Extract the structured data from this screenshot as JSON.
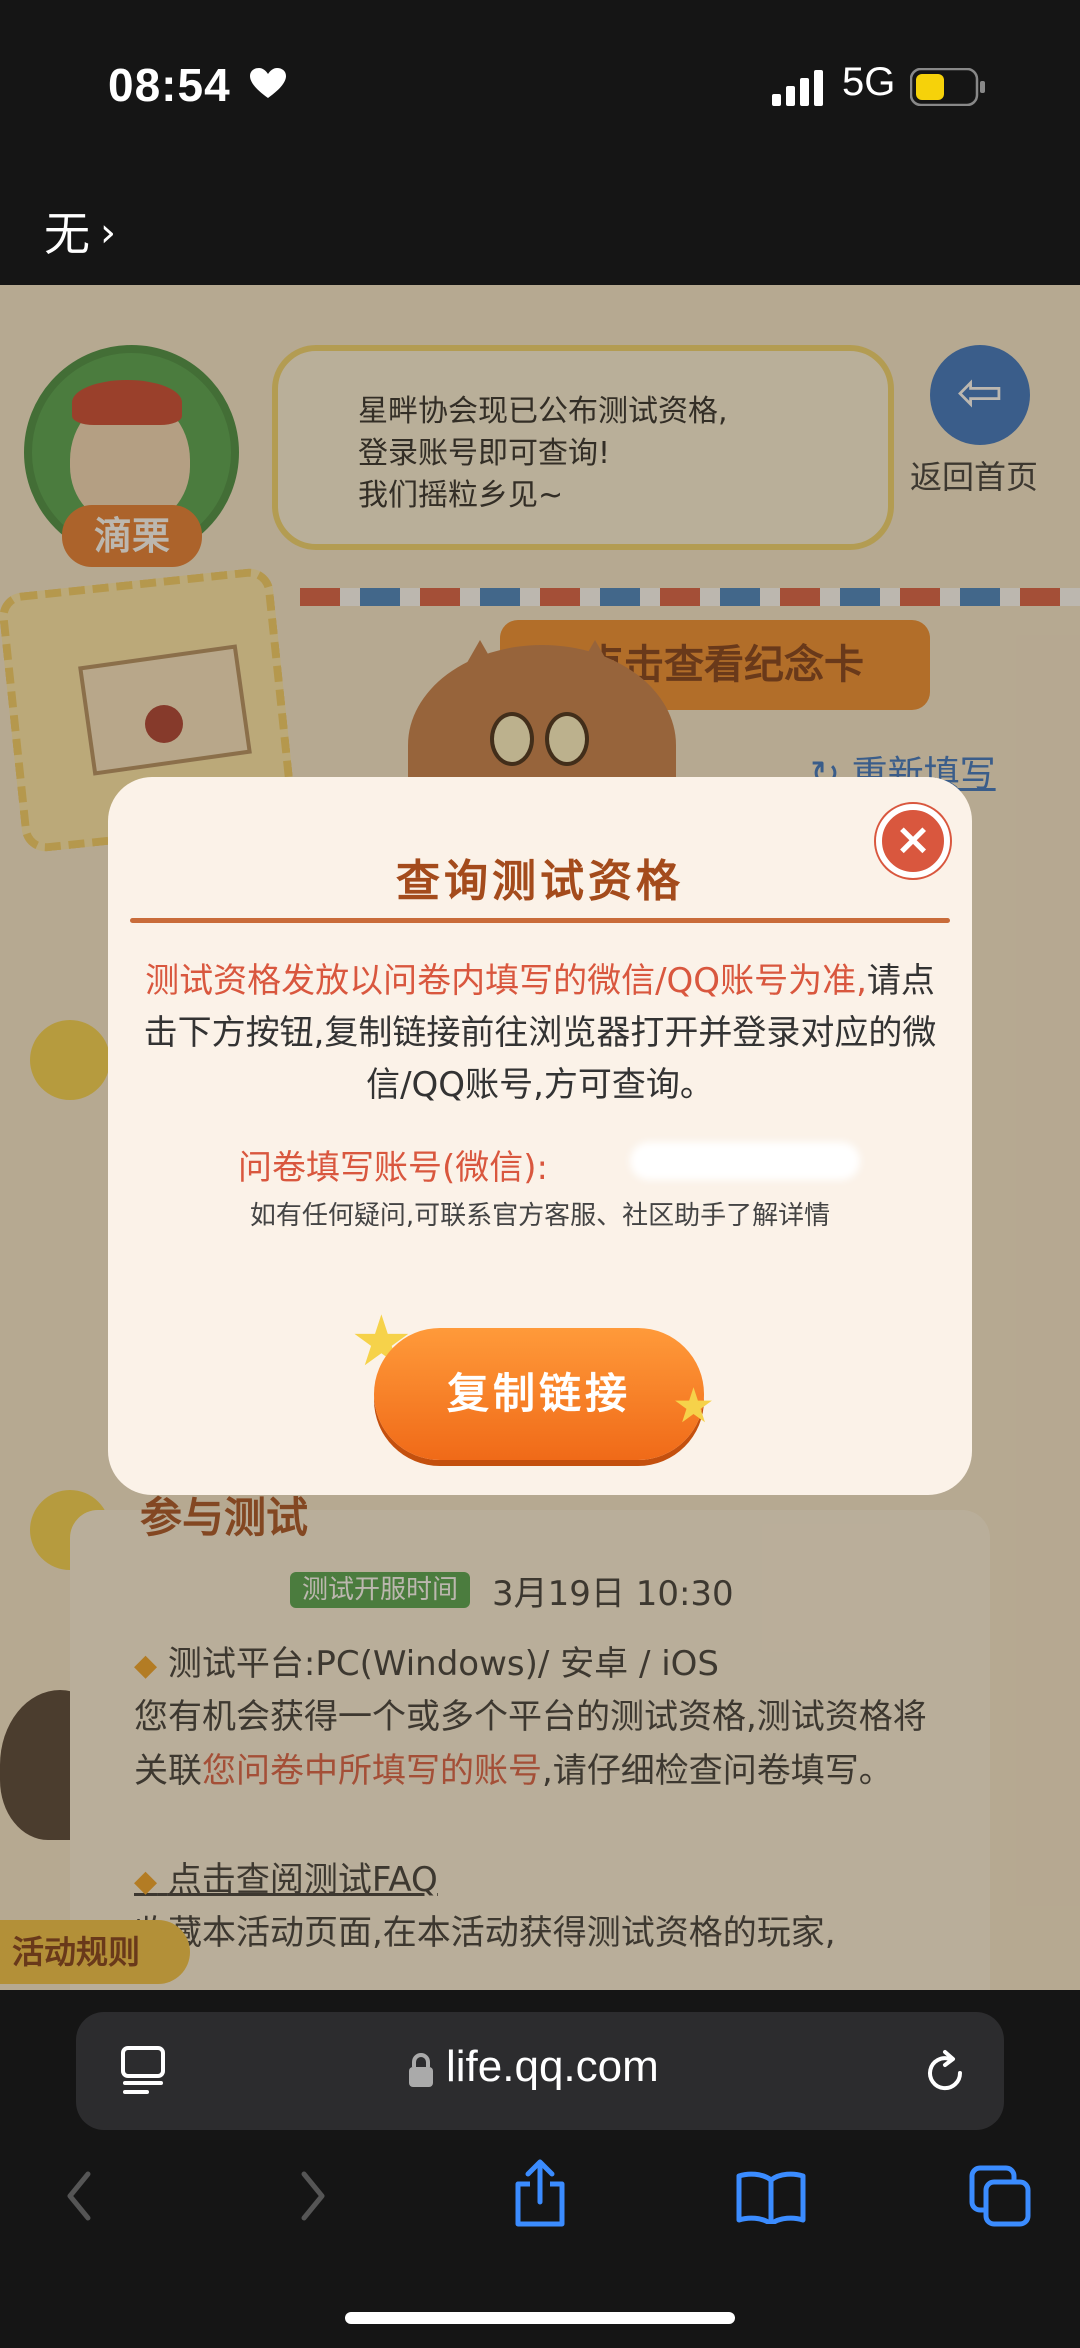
{
  "status": {
    "time": "08:54",
    "network": "5G"
  },
  "nav": {
    "back_label": "无"
  },
  "page": {
    "mascot_name": "滴栗",
    "bubble_lines": [
      "星畔协会现已公布测试资格,",
      "登录账号即可查询!",
      "我们摇粒乡见~"
    ],
    "home_label": "返回首页",
    "memorial_button": "点击查看纪念卡",
    "refill_link": "重新填写",
    "section_title": "参与测试",
    "time_badge": "测试开服时间",
    "time_value": "3月19日  10:30",
    "platform": "测试平台:PC(Windows)/ 安卓 / iOS",
    "para_part1": "您有机会获得一个或多个平台的测试资格,测试资格将关联",
    "para_highlight": "您问卷中所填写的账号",
    "para_part2": ",请仔细检查问卷填写。",
    "faq_link": "点击查阅测试FAQ",
    "save_page": "收藏本活动页面,在本活动获得测试资格的玩家,",
    "rules_tab": "活动规则"
  },
  "modal": {
    "title": "查询测试资格",
    "close_symbol": "×",
    "body_highlight": "测试资格发放以问卷内填写的微信/QQ账号为准,",
    "body_rest": "请点击下方按钮,复制链接前往浏览器打开并登录对应的微信/QQ账号,方可查询。",
    "account_label": "问卷填写账号(微信):",
    "note": "如有任何疑问,可联系官方客服、社区助手了解详情",
    "copy_button": "复制链接"
  },
  "browser": {
    "url": "life.qq.com"
  },
  "colors": {
    "accent": "#ef8a28",
    "title": "#a44b1c",
    "highlight": "#d9573e",
    "link": "#2e6fc4"
  }
}
